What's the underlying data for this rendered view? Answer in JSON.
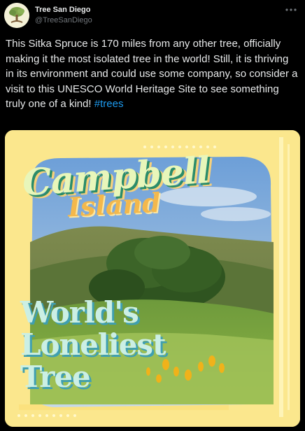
{
  "account": {
    "display_name": "Tree San Diego",
    "handle": "@TreeSanDiego"
  },
  "tweet": {
    "text": "This Sitka Spruce is 170 miles from any other tree, officially making it the most isolated tree in the world! Still, it is thriving in its environment and could use some company, so consider a visit to this UNESCO World Heritage Site to see something truly one of a kind! ",
    "hashtag": "#trees"
  },
  "media": {
    "title_script_line1": "Campbell",
    "title_script_line2": "Island",
    "headline_line1": "World's",
    "headline_line2": "Loneliest",
    "headline_line3": "Tree"
  },
  "icons": {
    "avatar": "tree-logo-icon",
    "more": "more-dots-icon"
  },
  "colors": {
    "background": "#000000",
    "text": "#e7e9ea",
    "secondary_text": "#71767b",
    "link": "#1d9bf0",
    "poster_yellow": "#f9e37a"
  }
}
